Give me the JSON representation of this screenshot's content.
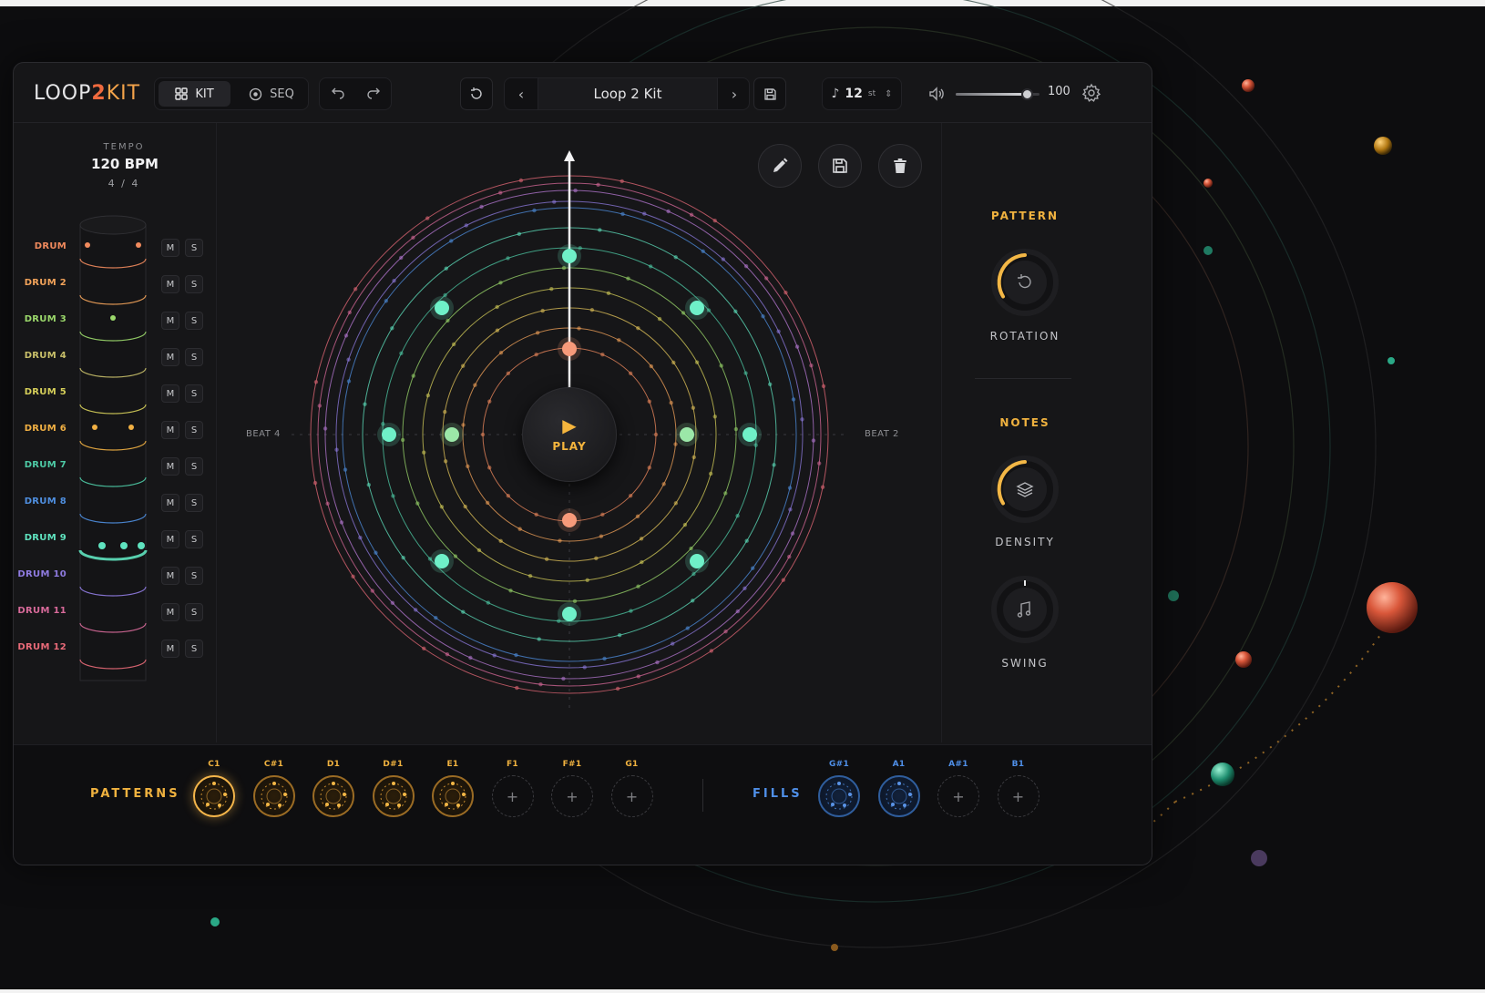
{
  "app": {
    "logo": {
      "part1": "LOOP",
      "part2": "2",
      "part3": "KIT"
    },
    "mode_tabs": [
      {
        "label": "KIT",
        "icon": "grid-icon",
        "active": true
      },
      {
        "label": "SEQ",
        "icon": "target-icon",
        "active": false
      }
    ],
    "preset_name": "Loop 2 Kit",
    "transpose": {
      "value": "12",
      "unit": "st"
    },
    "volume": {
      "value": "100",
      "level": 0.85
    }
  },
  "tempo": {
    "label": "TEMPO",
    "bpm": "120 BPM",
    "signature": "4 / 4"
  },
  "tracks": [
    {
      "name": "DRUM",
      "color": "#f08a5d"
    },
    {
      "name": "DRUM 2",
      "color": "#f3a35a"
    },
    {
      "name": "DRUM 3",
      "color": "#9bd86b"
    },
    {
      "name": "DRUM 4",
      "color": "#c9c06a"
    },
    {
      "name": "DRUM 5",
      "color": "#d6cf5a"
    },
    {
      "name": "DRUM 6",
      "color": "#f1b043"
    },
    {
      "name": "DRUM 7",
      "color": "#4ecba6"
    },
    {
      "name": "DRUM 8",
      "color": "#4f8fe0"
    },
    {
      "name": "DRUM 9",
      "color": "#5fe3bf"
    },
    {
      "name": "DRUM 10",
      "color": "#8f7be0"
    },
    {
      "name": "DRUM 11",
      "color": "#d86a9a"
    },
    {
      "name": "DRUM 12",
      "color": "#e86a78"
    }
  ],
  "mute_label": "M",
  "solo_label": "S",
  "center": {
    "play_label": "PLAY",
    "beat_left": "BEAT 4",
    "beat_right": "BEAT 2"
  },
  "right_panel": {
    "pattern_title": "PATTERN",
    "rotation_label": "ROTATION",
    "notes_title": "NOTES",
    "density_label": "DENSITY",
    "swing_label": "SWING"
  },
  "bottom": {
    "patterns_label": "PATTERNS",
    "fills_label": "FILLS",
    "patterns": [
      {
        "note": "C1",
        "filled": true,
        "active": true
      },
      {
        "note": "C#1",
        "filled": true,
        "active": false
      },
      {
        "note": "D1",
        "filled": true,
        "active": false
      },
      {
        "note": "D#1",
        "filled": true,
        "active": false
      },
      {
        "note": "E1",
        "filled": true,
        "active": false
      },
      {
        "note": "F1",
        "filled": false,
        "active": false
      },
      {
        "note": "F#1",
        "filled": false,
        "active": false
      },
      {
        "note": "G1",
        "filled": false,
        "active": false
      }
    ],
    "fills": [
      {
        "note": "G#1",
        "filled": true
      },
      {
        "note": "A1",
        "filled": true
      },
      {
        "note": "A#1",
        "filled": false
      },
      {
        "note": "B1",
        "filled": false
      }
    ],
    "add_symbol": "+"
  },
  "colors": {
    "accent": "#f0b23f",
    "fill_accent": "#4f8fe8",
    "hit_teal": "#6ff0c8",
    "hit_coral": "#f79a7a"
  }
}
